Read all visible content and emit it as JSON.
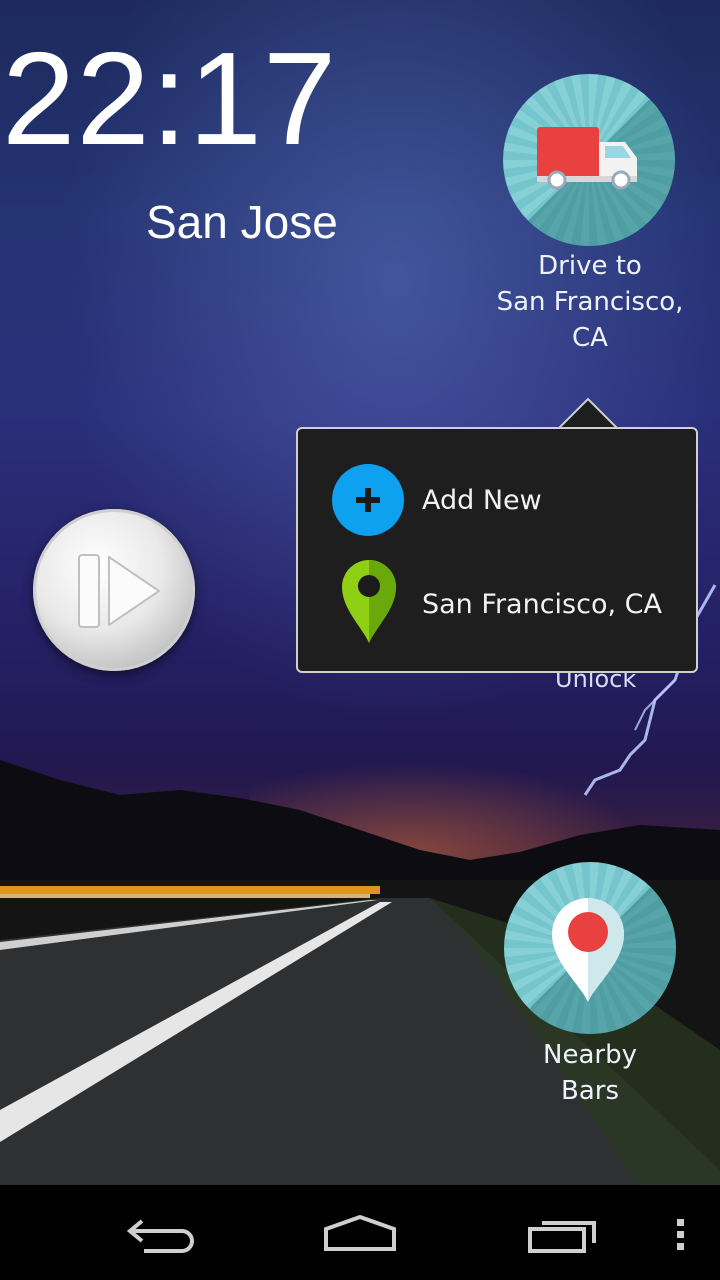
{
  "clock": {
    "time": "22:17",
    "city": "San Jose"
  },
  "shortcuts": {
    "drive": {
      "line1": "Drive to",
      "line2": "San Francisco, CA",
      "icon": "delivery-truck-icon"
    },
    "bars": {
      "line1": "Nearby",
      "line2": "Bars",
      "icon": "map-pin-icon"
    }
  },
  "unlock": {
    "label": "Unlock"
  },
  "popup": {
    "items": [
      {
        "label": "Add New",
        "icon": "add-circle-icon",
        "color": "#0ea1f0"
      },
      {
        "label": "San Francisco, CA",
        "icon": "location-pin-icon",
        "color": "#8fcf14"
      }
    ]
  },
  "play": {
    "icon": "play-pause-icon"
  },
  "navbar": {
    "icons": [
      "back-icon",
      "home-icon",
      "recent-apps-icon",
      "overflow-menu-icon"
    ]
  },
  "colors": {
    "shortcut_bg": "#86d0d6",
    "popup_bg": "#1e1e1f",
    "truck": "#e8413f"
  }
}
